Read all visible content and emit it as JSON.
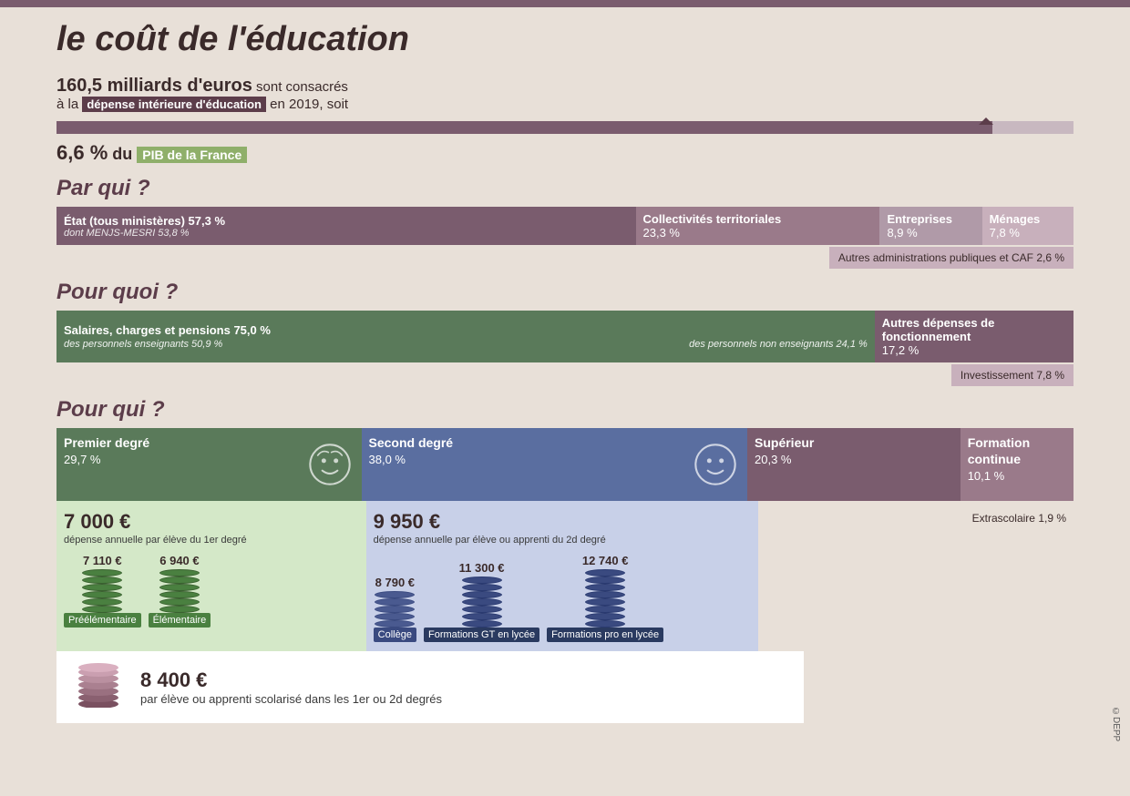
{
  "page": {
    "title": "le coût de l'éducation",
    "intro": {
      "amount": "160,5 milliards d'euros",
      "text1": "sont consacrés",
      "text2": "à la",
      "highlight1": "dépense intérieure d'éducation",
      "text3": "en 2019, soit",
      "pct": "6,6 %",
      "text4": "du",
      "highlight2": "PIB de la France"
    },
    "par_qui_title": "Par qui ?",
    "par_qui": {
      "etat": {
        "label": "État (tous ministères)",
        "pct": "57,3 %",
        "sub": "dont MENJS-MESRI 53,8 %"
      },
      "collectivites": {
        "label": "Collectivités territoriales",
        "pct": "23,3 %"
      },
      "entreprises": {
        "label": "Entreprises",
        "pct": "8,9 %"
      },
      "menages": {
        "label": "Ménages",
        "pct": "7,8 %"
      },
      "autres": {
        "label": "Autres administrations publiques et CAF",
        "pct": "2,6 %"
      }
    },
    "pour_quoi_title": "Pour quoi ?",
    "pour_quoi": {
      "salaires": {
        "label": "Salaires, charges et pensions",
        "pct": "75,0 %",
        "sub1": "des personnels enseignants 50,9 %",
        "sub2": "des personnels non enseignants 24,1 %"
      },
      "autres_dep": {
        "label": "Autres dépenses de fonctionnement",
        "pct": "17,2 %"
      },
      "investissement": {
        "label": "Investissement",
        "pct": "7,8 %"
      }
    },
    "pour_qui_title2": "Pour qui ?",
    "pour_qui2": {
      "premier": {
        "label": "Premier degré",
        "pct": "29,7 %"
      },
      "second": {
        "label": "Second degré",
        "pct": "38,0 %"
      },
      "superieur": {
        "label": "Supérieur",
        "pct": "20,3 %"
      },
      "formation": {
        "label": "Formation continue",
        "pct": "10,1 %"
      },
      "extrascolaire": {
        "label": "Extrascolaire",
        "pct": "1,9 %"
      }
    },
    "costs": {
      "premier": {
        "amount": "7 000 €",
        "label": "dépense annuelle par élève du 1er degré",
        "preem": {
          "amount": "7 110 €",
          "label": "Préélémentaire"
        },
        "elem": {
          "amount": "6 940 €",
          "label": "Élémentaire"
        }
      },
      "second": {
        "amount": "9 950 €",
        "label": "dépense annuelle par élève ou apprenti du 2d degré",
        "college": {
          "amount": "8 790 €",
          "label": "Collège"
        },
        "formations_gt": {
          "amount": "11 300 €",
          "label": "Formations GT en lycée"
        },
        "formations_pro": {
          "amount": "12 740 €",
          "label": "Formations pro en lycée"
        }
      },
      "bottom": {
        "amount": "8 400 €",
        "label": "par élève ou apprenti scolarisé dans les 1er ou 2d degrés"
      }
    },
    "copyright": "©DEPP"
  }
}
